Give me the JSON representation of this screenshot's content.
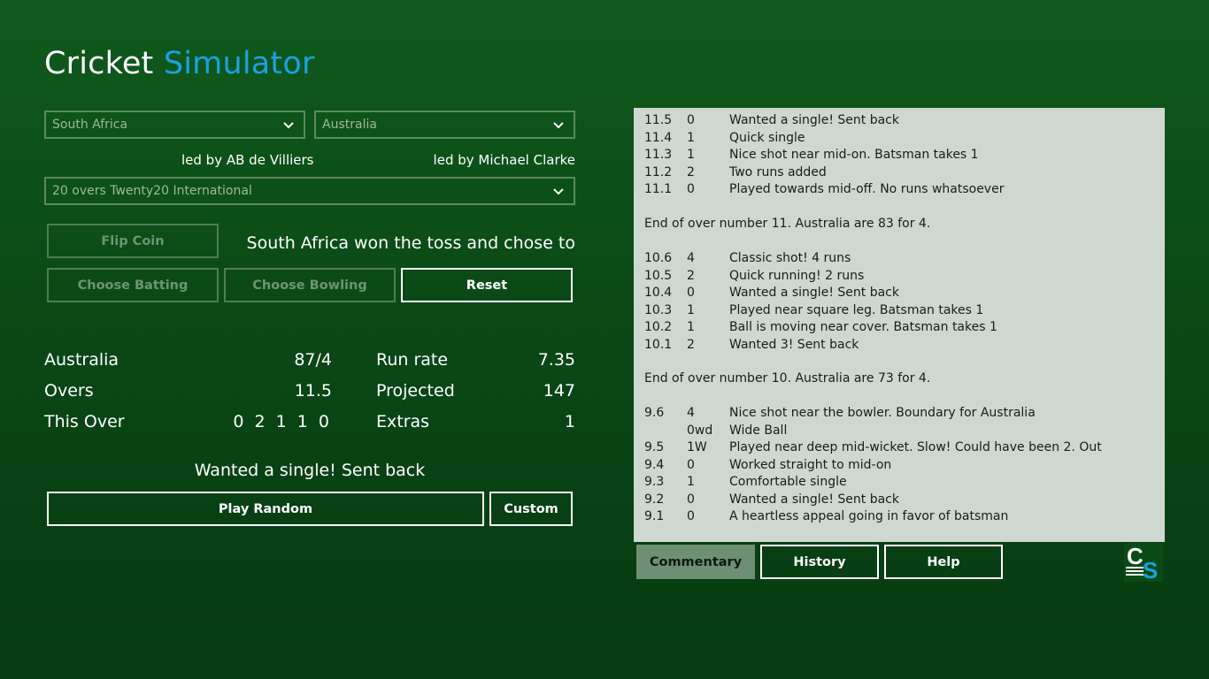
{
  "app": {
    "title_part1": "Cricket",
    "title_part2": "Simulator",
    "accent_color": "#1ba1e2"
  },
  "setup": {
    "team1": "South Africa",
    "team2": "Australia",
    "team1_captain": "led by AB de Villiers",
    "team2_captain": "led by Michael Clarke",
    "format": "20 overs Twenty20 International",
    "toss_result": "South Africa won the toss and chose to"
  },
  "buttons": {
    "flip_coin": "Flip Coin",
    "choose_batting": "Choose Batting",
    "choose_bowling": "Choose Bowling",
    "reset": "Reset",
    "play_random": "Play Random",
    "custom": "Custom"
  },
  "score": {
    "team_label": "Australia",
    "team_score": "87/4",
    "overs_label": "Overs",
    "overs_value": "11.5",
    "this_over_label": "This Over",
    "this_over_value": "0 2 1 1 0",
    "run_rate_label": "Run rate",
    "run_rate_value": "7.35",
    "projected_label": "Projected",
    "projected_value": "147",
    "extras_label": "Extras",
    "extras_value": "1"
  },
  "last_ball": "Wanted a single! Sent back",
  "commentary": {
    "over11": [
      {
        "ball": "11.5",
        "runs": "0",
        "text": "Wanted a single! Sent back"
      },
      {
        "ball": "11.4",
        "runs": "1",
        "text": "Quick single"
      },
      {
        "ball": "11.3",
        "runs": "1",
        "text": "Nice shot near mid-on. Batsman takes 1"
      },
      {
        "ball": "11.2",
        "runs": "2",
        "text": "Two runs added"
      },
      {
        "ball": "11.1",
        "runs": "0",
        "text": "Played towards mid-off. No runs whatsoever"
      }
    ],
    "summary11": "End of over number 11. Australia are 83 for 4.",
    "over10": [
      {
        "ball": "10.6",
        "runs": "4",
        "text": "Classic shot! 4 runs"
      },
      {
        "ball": "10.5",
        "runs": "2",
        "text": "Quick running! 2 runs"
      },
      {
        "ball": "10.4",
        "runs": "0",
        "text": "Wanted a single! Sent back"
      },
      {
        "ball": "10.3",
        "runs": "1",
        "text": "Played near square leg. Batsman takes 1"
      },
      {
        "ball": "10.2",
        "runs": "1",
        "text": "Ball is moving near cover. Batsman takes 1"
      },
      {
        "ball": "10.1",
        "runs": "2",
        "text": "Wanted 3! Sent back"
      }
    ],
    "summary10": "End of over number 10. Australia are 73 for 4.",
    "over9": [
      {
        "ball": "9.6",
        "runs": "4",
        "text": "Nice shot near the bowler. Boundary for Australia"
      },
      {
        "ball": "",
        "runs": "0wd",
        "text": "Wide Ball"
      },
      {
        "ball": "9.5",
        "runs": "1W",
        "text": "Played near deep mid-wicket. Slow! Could have been 2. Out"
      },
      {
        "ball": "9.4",
        "runs": "0",
        "text": "Worked straight to mid-on"
      },
      {
        "ball": "9.3",
        "runs": "1",
        "text": "Comfortable single"
      },
      {
        "ball": "9.2",
        "runs": "0",
        "text": "Wanted a single! Sent back"
      },
      {
        "ball": "9.1",
        "runs": "0",
        "text": "A heartless appeal going in favor of batsman"
      }
    ]
  },
  "tabs": {
    "commentary": "Commentary",
    "history": "History",
    "help": "Help"
  },
  "logo": {
    "letters": "CS",
    "letter1": "C",
    "letter2": "S"
  }
}
